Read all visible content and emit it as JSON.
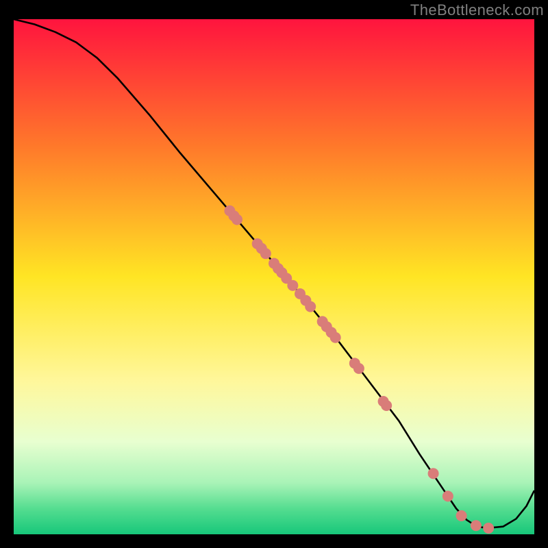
{
  "watermark": "TheBottleneck.com",
  "chart_data": {
    "type": "line",
    "title": "",
    "xlabel": "",
    "ylabel": "",
    "xlim": [
      0,
      100
    ],
    "ylim": [
      0,
      100
    ],
    "curve": [
      {
        "x": 0,
        "y": 100
      },
      {
        "x": 4,
        "y": 99
      },
      {
        "x": 8,
        "y": 97.5
      },
      {
        "x": 12,
        "y": 95.5
      },
      {
        "x": 16,
        "y": 92.5
      },
      {
        "x": 20,
        "y": 88.5
      },
      {
        "x": 26,
        "y": 81.5
      },
      {
        "x": 32,
        "y": 74
      },
      {
        "x": 40,
        "y": 64.5
      },
      {
        "x": 48,
        "y": 55
      },
      {
        "x": 56,
        "y": 45.5
      },
      {
        "x": 62,
        "y": 38
      },
      {
        "x": 68,
        "y": 30
      },
      {
        "x": 74,
        "y": 22
      },
      {
        "x": 78,
        "y": 15.5
      },
      {
        "x": 82,
        "y": 9.5
      },
      {
        "x": 85,
        "y": 5
      },
      {
        "x": 87,
        "y": 2.8
      },
      {
        "x": 89,
        "y": 1.5
      },
      {
        "x": 91,
        "y": 1.2
      },
      {
        "x": 94,
        "y": 1.5
      },
      {
        "x": 96.5,
        "y": 3
      },
      {
        "x": 98.5,
        "y": 5.5
      },
      {
        "x": 100,
        "y": 8.5
      }
    ],
    "scatter": [
      {
        "x": 41.5,
        "y": 62.8
      },
      {
        "x": 42.3,
        "y": 61.8
      },
      {
        "x": 42.9,
        "y": 61.1
      },
      {
        "x": 46.8,
        "y": 56.4
      },
      {
        "x": 47.6,
        "y": 55.5
      },
      {
        "x": 48.4,
        "y": 54.5
      },
      {
        "x": 50.0,
        "y": 52.6
      },
      {
        "x": 50.8,
        "y": 51.6
      },
      {
        "x": 51.5,
        "y": 50.8
      },
      {
        "x": 52.4,
        "y": 49.7
      },
      {
        "x": 53.6,
        "y": 48.3
      },
      {
        "x": 55.0,
        "y": 46.7
      },
      {
        "x": 56.1,
        "y": 45.4
      },
      {
        "x": 57.0,
        "y": 44.2
      },
      {
        "x": 59.3,
        "y": 41.3
      },
      {
        "x": 60.1,
        "y": 40.3
      },
      {
        "x": 61.0,
        "y": 39.2
      },
      {
        "x": 61.8,
        "y": 38.2
      },
      {
        "x": 65.5,
        "y": 33.2
      },
      {
        "x": 66.3,
        "y": 32.2
      },
      {
        "x": 71.0,
        "y": 25.8
      },
      {
        "x": 71.6,
        "y": 25.0
      },
      {
        "x": 80.6,
        "y": 11.8
      },
      {
        "x": 83.4,
        "y": 7.4
      },
      {
        "x": 86.0,
        "y": 3.6
      },
      {
        "x": 88.8,
        "y": 1.7
      },
      {
        "x": 91.2,
        "y": 1.2
      }
    ],
    "gradient_stops": [
      {
        "pos": 0.0,
        "color": "#ff143e"
      },
      {
        "pos": 0.25,
        "color": "#ff7a2a"
      },
      {
        "pos": 0.5,
        "color": "#ffe524"
      },
      {
        "pos": 0.7,
        "color": "#fff79a"
      },
      {
        "pos": 0.82,
        "color": "#e8ffd0"
      },
      {
        "pos": 0.9,
        "color": "#a9f3b7"
      },
      {
        "pos": 0.95,
        "color": "#55dd90"
      },
      {
        "pos": 1.0,
        "color": "#17c77a"
      }
    ],
    "scatter_color": "#d97d79",
    "curve_color": "#000000"
  }
}
